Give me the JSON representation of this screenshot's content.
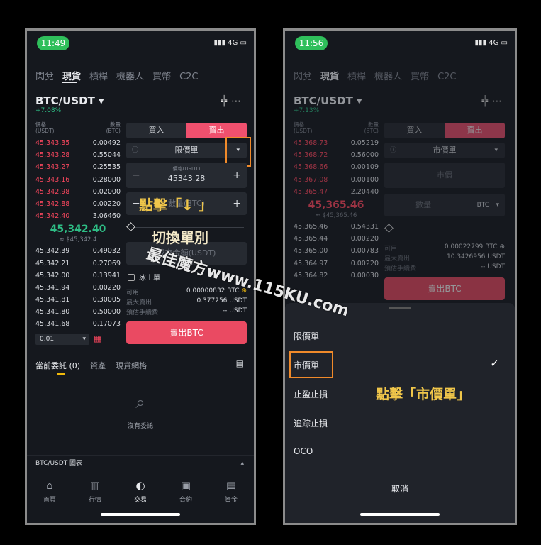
{
  "left": {
    "time": "11:49",
    "network": "4G",
    "tabs": [
      "閃兌",
      "現貨",
      "槓桿",
      "機器人",
      "買幣",
      "C2C"
    ],
    "pair": "BTC/USDT ▾",
    "change": "+7.08%",
    "hdr_price": "價格",
    "hdr_price_unit": "(USDT)",
    "hdr_qty": "數量",
    "hdr_qty_unit": "(BTC)",
    "asks": [
      [
        "45,343.35",
        "0.00492"
      ],
      [
        "45,343.28",
        "0.55044"
      ],
      [
        "45,343.27",
        "0.25535"
      ],
      [
        "45,343.16",
        "0.28000"
      ],
      [
        "45,342.98",
        "0.02000"
      ],
      [
        "45,342.88",
        "0.00220"
      ],
      [
        "45,342.40",
        "3.06460"
      ]
    ],
    "mid": "45,342.40",
    "mid_sub": "≈ $45,342.4",
    "bids": [
      [
        "45,342.39",
        "0.49032"
      ],
      [
        "45,342.21",
        "0.27069"
      ],
      [
        "45,342.00",
        "0.13941"
      ],
      [
        "45,341.94",
        "0.00220"
      ],
      [
        "45,341.81",
        "0.30005"
      ],
      [
        "45,341.80",
        "0.50000"
      ],
      [
        "45,341.68",
        "0.17073"
      ]
    ],
    "depth": "0.01",
    "buy": "買入",
    "sell": "賣出",
    "order_type": "限價單",
    "price_label": "價格(USDT)",
    "price_value": "45343.28",
    "qty_placeholder": "數量(BTC)",
    "total_placeholder": "成交金額(USDT)",
    "iceberg": "冰山單",
    "avail_label": "可用",
    "avail_value": "0.00000832 BTC",
    "maxsell_label": "最大賣出",
    "maxsell_value": "0.377256 USDT",
    "fee_label": "預估手續費",
    "fee_value": "-- USDT",
    "sell_btn": "賣出BTC",
    "tab_orders": "當前委託 (0)",
    "tab_assets": "資產",
    "tab_grid": "現貨網格",
    "empty": "沒有委託",
    "chart_bar": "BTC/USDT 圖表",
    "nav": [
      "首頁",
      "行情",
      "交易",
      "合約",
      "資金"
    ],
    "overlay1": "點擊「↓ 」",
    "overlay2": "切換單別"
  },
  "right": {
    "time": "11:56",
    "network": "4G",
    "tabs": [
      "閃兌",
      "現貨",
      "槓桿",
      "機器人",
      "買幣",
      "C2C"
    ],
    "pair": "BTC/USDT ▾",
    "change": "+7.13%",
    "hdr_price": "價格",
    "hdr_price_unit": "(USDT)",
    "hdr_qty": "數量",
    "hdr_qty_unit": "(BTC)",
    "asks": [
      [
        "45,368.73",
        "0.05219"
      ],
      [
        "45,368.72",
        "0.56000"
      ],
      [
        "45,368.66",
        "0.00109"
      ],
      [
        "45,367.08",
        "0.00100"
      ],
      [
        "45,365.47",
        "2.20440"
      ]
    ],
    "mid": "45,365.46",
    "mid_sub": "≈ $45,365.46",
    "bids": [
      [
        "45,365.46",
        "0.54331"
      ],
      [
        "45,365.44",
        "0.00220"
      ],
      [
        "45,365.00",
        "0.00783"
      ],
      [
        "45,364.97",
        "0.00220"
      ],
      [
        "45,364.82",
        "0.00030"
      ]
    ],
    "buy": "買入",
    "sell": "賣出",
    "order_type": "市價單",
    "market_label": "市價",
    "qty_label": "數量",
    "qty_unit": "BTC",
    "avail_label": "可用",
    "avail_value": "0.00022799 BTC",
    "maxsell_label": "最大賣出",
    "maxsell_value": "10.3426956 USDT",
    "fee_label": "預估手續費",
    "fee_value": "-- USDT",
    "sell_btn": "賣出BTC",
    "options": [
      "限價單",
      "市價單",
      "止盈止損",
      "追踪止損",
      "OCO"
    ],
    "cancel": "取消",
    "overlay": "點擊「市價單」"
  },
  "watermark": "最佳魔方www.115KU.com",
  "colors": {
    "red": "#f6465d",
    "green": "#2ebd85",
    "orange": "#f08a2a",
    "highlight": "#f0c64a"
  }
}
